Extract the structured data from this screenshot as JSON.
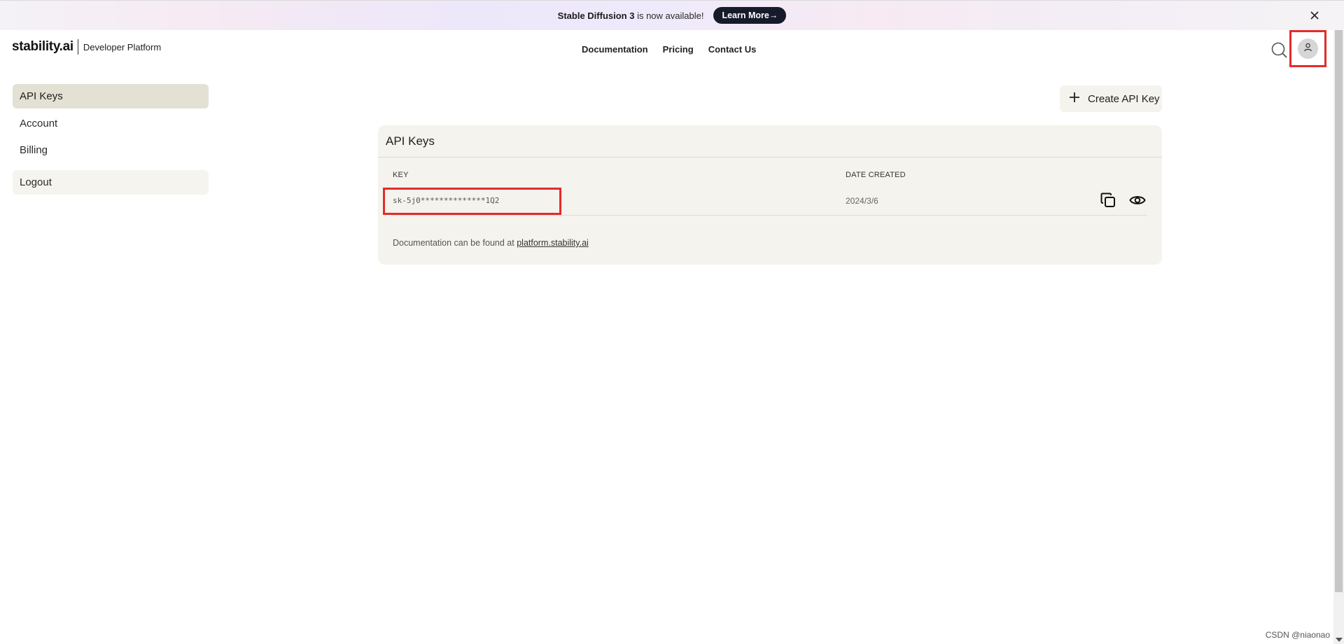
{
  "banner": {
    "title_bold": "Stable Diffusion 3",
    "title_rest": " is now available!",
    "button_label": "Learn More→",
    "close_icon": "close-icon"
  },
  "header": {
    "brand": "stability.ai",
    "subtitle": "Developer Platform",
    "nav": [
      "Documentation",
      "Pricing",
      "Contact Us"
    ],
    "search_icon": "search-icon",
    "avatar_icon": "user-icon"
  },
  "sidebar": {
    "items": [
      {
        "label": "API Keys",
        "active": true
      },
      {
        "label": "Account",
        "active": false
      },
      {
        "label": "Billing",
        "active": false
      }
    ],
    "logout_label": "Logout"
  },
  "main": {
    "create_button_label": "Create API Key",
    "card_title": "API Keys",
    "columns": [
      "KEY",
      "DATE CREATED"
    ],
    "rows": [
      {
        "key": "sk-5j0**************1Q2",
        "date_created": "2024/3/6"
      }
    ],
    "footer_prefix": "Documentation can be found at ",
    "footer_link": "platform.stability.ai"
  },
  "watermark": "CSDN @niaonao",
  "colors": {
    "highlight_box": "#e32b2b",
    "active_nav_bg": "#e3e1d3",
    "card_bg": "#f4f3ed",
    "banner_button_bg": "#161b2b"
  }
}
